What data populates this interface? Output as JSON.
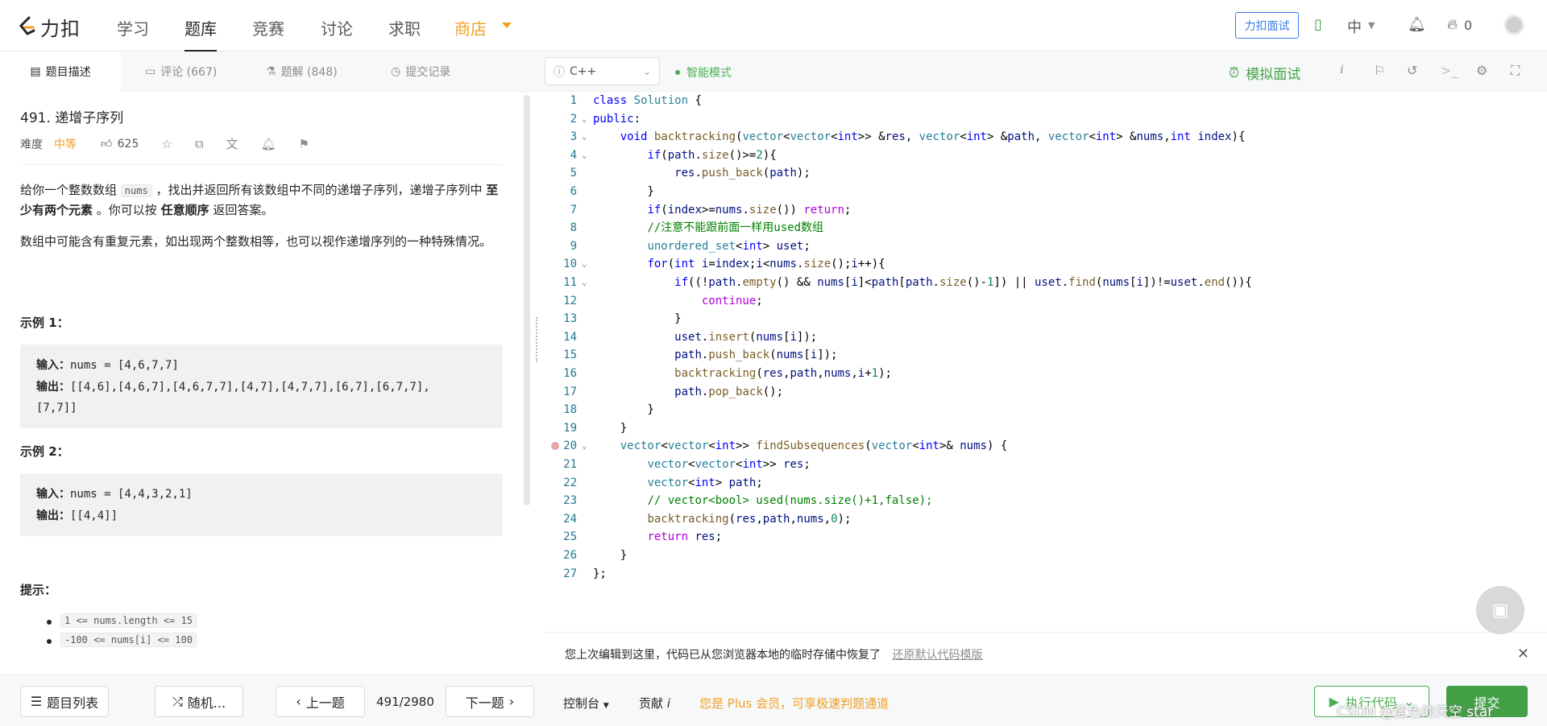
{
  "topnav": {
    "logo_text": "力扣",
    "items": [
      "学习",
      "题库",
      "竞赛",
      "讨论",
      "求职",
      "商店"
    ],
    "interview_button": "力扣面试",
    "lang": "中",
    "points": "0"
  },
  "tabs": [
    {
      "label": "题目描述",
      "icon": "description-icon"
    },
    {
      "label": "评论 (667)",
      "icon": "comment-icon"
    },
    {
      "label": "题解 (848)",
      "icon": "flask-icon"
    },
    {
      "label": "提交记录",
      "icon": "clock-icon"
    }
  ],
  "editor_bar": {
    "language": "C++",
    "smart_mode": "智能模式",
    "mock_interview": "模拟面试"
  },
  "problem": {
    "title": "491. 递增子序列",
    "difficulty_label": "难度",
    "difficulty": "中等",
    "likes": "625",
    "desc_1a": "给你一个整数数组",
    "desc_code": "nums",
    "desc_1b": "，找出并返回所有该数组中不同的递增子序列，递增子序列中",
    "desc_bold1": "至少有两个元素",
    "desc_1c": "。你可以按",
    "desc_bold2": "任意顺序",
    "desc_1d": "返回答案。",
    "desc_2": "数组中可能含有重复元素，如出现两个整数相等，也可以视作递增序列的一种特殊情况。",
    "example1_title": "示例 1：",
    "example1_input_label": "输入：",
    "example1_input": "nums = [4,6,7,7]",
    "example1_output_label": "输出：",
    "example1_output_a": "[[4,6],[4,6,7],[4,6,7,7],[4,7],[4,7,7],[6,7],[6,7,7],",
    "example1_output_b": "[7,7]]",
    "example2_title": "示例 2：",
    "example2_input_label": "输入：",
    "example2_input": "nums = [4,4,3,2,1]",
    "example2_output_label": "输出：",
    "example2_output": "[[4,4]]",
    "hints_title": "提示：",
    "hints": [
      "1 <= nums.length <= 15",
      "-100 <= nums[i] <= 100"
    ]
  },
  "code_lines": [
    "class Solution {",
    "public:",
    "    void backtracking(vector<vector<int>> &res, vector<int> &path, vector<int> &nums,int index){",
    "        if(path.size()>=2){",
    "            res.push_back(path);",
    "        }",
    "        if(index>=nums.size()) return;",
    "        //注意不能跟前面一样用used数组",
    "        unordered_set<int> uset;",
    "        for(int i=index;i<nums.size();i++){",
    "            if((!path.empty() && nums[i]<path[path.size()-1]) || uset.find(nums[i])!=uset.end()){",
    "                continue;",
    "            }",
    "            uset.insert(nums[i]);",
    "            path.push_back(nums[i]);",
    "            backtracking(res,path,nums,i+1);",
    "            path.pop_back();",
    "        }",
    "    }",
    "    vector<vector<int>> findSubsequences(vector<int>& nums) {",
    "        vector<vector<int>> res;",
    "        vector<int> path;",
    "        // vector<bool> used(nums.size()+1,false);",
    "        backtracking(res,path,nums,0);",
    "        return res;",
    "    }",
    "};"
  ],
  "restore": {
    "message": "您上次编辑到这里，代码已从您浏览器本地的临时存储中恢复了",
    "link": "还原默认代码模版"
  },
  "bottom": {
    "problem_list": "题目列表",
    "random": "随机...",
    "prev": "上一题",
    "counter": "491/2980",
    "next": "下一题",
    "console": "控制台",
    "contribute": "贡献",
    "plus_msg": "您是 Plus 会员，可享极速判题通道",
    "run": "执行代码",
    "submit": "提交"
  },
  "watermark": "CSDN @蓝色的天空    star"
}
